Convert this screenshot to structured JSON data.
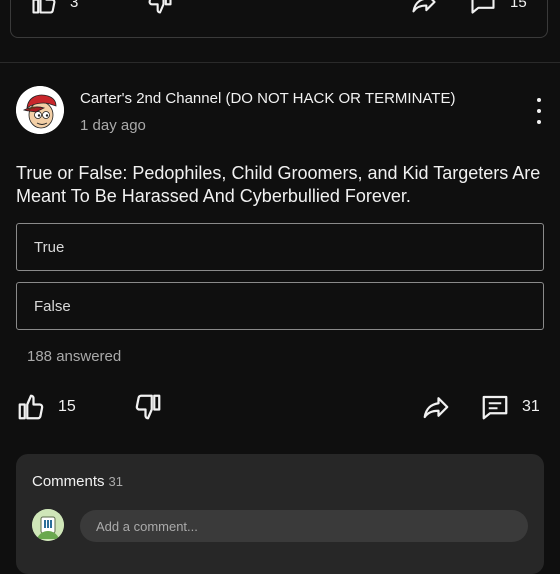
{
  "previous_post": {
    "like_count": "3",
    "comment_count": "15"
  },
  "post": {
    "channel_name": "Carter's 2nd Channel (DO NOT HACK OR TERMINATE)",
    "time_ago": "1 day ago",
    "question": "True or False: Pedophiles, Child Groomers, and Kid Targeters Are Meant To Be Harassed And Cyberbullied Forever.",
    "options": [
      "True",
      "False"
    ],
    "answered": "188 answered",
    "like_count": "15",
    "comment_count": "31"
  },
  "comments": {
    "title": "Comments",
    "count": "31",
    "input_placeholder": "Add a comment..."
  },
  "icons": {
    "like": "thumbs-up-icon",
    "dislike": "thumbs-down-icon",
    "share": "share-icon",
    "comment": "comment-icon",
    "more": "more-vertical-icon"
  }
}
